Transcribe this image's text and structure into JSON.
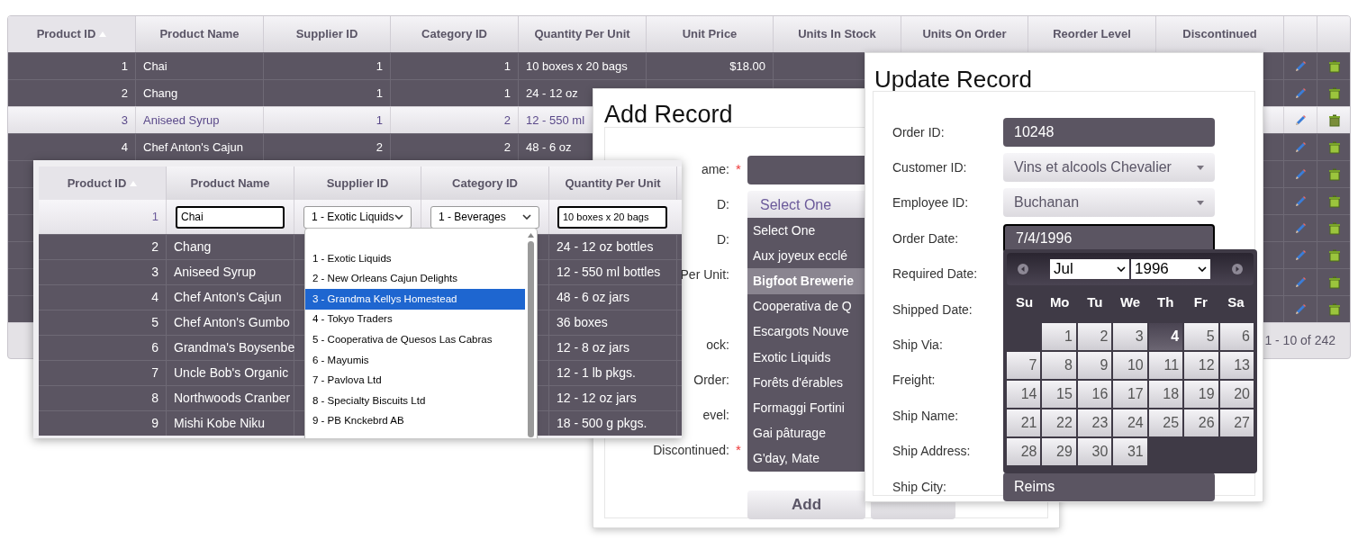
{
  "main_grid": {
    "columns": [
      {
        "label": "Product ID",
        "sorted": true
      },
      {
        "label": "Product Name",
        "sorted": false
      },
      {
        "label": "Supplier ID",
        "sorted": false
      },
      {
        "label": "Category ID",
        "sorted": false
      },
      {
        "label": "Quantity Per Unit",
        "sorted": false
      },
      {
        "label": "Unit Price",
        "sorted": false
      },
      {
        "label": "Units In Stock",
        "sorted": false
      },
      {
        "label": "Units On Order",
        "sorted": false
      },
      {
        "label": "Reorder Level",
        "sorted": false
      },
      {
        "label": "Discontinued",
        "sorted": false
      }
    ],
    "rows": [
      {
        "selected": false,
        "cells": [
          "1",
          "Chai",
          "1",
          "1",
          "10 boxes x 20 bags",
          "$18.00"
        ]
      },
      {
        "selected": false,
        "cells": [
          "2",
          "Chang",
          "1",
          "1",
          "24 - 12 oz"
        ]
      },
      {
        "selected": true,
        "cells": [
          "3",
          "Aniseed Syrup",
          "1",
          "2",
          "12 - 550 ml"
        ]
      },
      {
        "selected": false,
        "cells": [
          "4",
          "Chef Anton's Cajun",
          "2",
          "2",
          "48 - 6 oz"
        ]
      },
      {
        "selected": false
      },
      {
        "selected": false
      },
      {
        "selected": false
      },
      {
        "selected": false
      },
      {
        "selected": false
      },
      {
        "selected": false
      }
    ],
    "pager": "1 - 10 of 242"
  },
  "product_grid": {
    "columns": [
      {
        "label": "Product ID",
        "sorted": true
      },
      {
        "label": "Product Name",
        "sorted": false
      },
      {
        "label": "Supplier ID",
        "sorted": false
      },
      {
        "label": "Category ID",
        "sorted": false
      },
      {
        "label": "Quantity Per Unit",
        "sorted": false
      }
    ],
    "edit_row": {
      "product_id": "1",
      "product_name": "Chai",
      "supplier": "1 - Exotic Liquids",
      "category": "1 - Beverages",
      "quantity_per_unit": "10 boxes x 20 bags"
    },
    "rows": [
      {
        "product_id": "2",
        "product_name": "Chang",
        "quantity_per_unit": "24 - 12 oz bottles"
      },
      {
        "product_id": "3",
        "product_name": "Aniseed Syrup",
        "quantity_per_unit": "12 - 550 ml bottles"
      },
      {
        "product_id": "4",
        "product_name": "Chef Anton's Cajun",
        "quantity_per_unit": "48 - 6 oz jars"
      },
      {
        "product_id": "5",
        "product_name": "Chef Anton's Gumbo",
        "quantity_per_unit": "36 boxes"
      },
      {
        "product_id": "6",
        "product_name": "Grandma's Boysenbe",
        "quantity_per_unit": "12 - 8 oz jars"
      },
      {
        "product_id": "7",
        "product_name": "Uncle Bob's Organic",
        "quantity_per_unit": "12 - 1 lb pkgs."
      },
      {
        "product_id": "8",
        "product_name": "Northwoods Cranber",
        "quantity_per_unit": "12 - 12 oz jars"
      },
      {
        "product_id": "9",
        "product_name": "Mishi Kobe Niku",
        "quantity_per_unit": "18 - 500 g pkgs."
      }
    ],
    "supplier_options": [
      {
        "label": "1 - Exotic Liquids",
        "selected": false
      },
      {
        "label": "2 - New Orleans Cajun Delights",
        "selected": false
      },
      {
        "label": "3 - Grandma Kellys Homestead",
        "selected": true
      },
      {
        "label": "4 - Tokyo Traders",
        "selected": false
      },
      {
        "label": "5 - Cooperativa de Quesos Las Cabras",
        "selected": false
      },
      {
        "label": "6 - Mayumis",
        "selected": false
      },
      {
        "label": "7 - Pavlova Ltd",
        "selected": false
      },
      {
        "label": "8 - Specialty Biscuits Ltd",
        "selected": false
      },
      {
        "label": "9 - PB Knckebrd AB",
        "selected": false
      }
    ]
  },
  "add_record": {
    "title": "Add Record",
    "fields": [
      {
        "label": "ame:",
        "required": true
      },
      {
        "label": "D:",
        "required": false
      },
      {
        "label": "D:",
        "required": false
      },
      {
        "label": "Per Unit:",
        "required": false
      },
      {
        "required": false
      },
      {
        "label": "ock:",
        "required": false
      },
      {
        "label": "Order:",
        "required": false
      },
      {
        "label": "evel:",
        "required": false
      },
      {
        "label": "Discontinued:",
        "required": true
      }
    ],
    "required_mark": "*",
    "supplier_select": "Select One",
    "supplier_options": [
      {
        "label": "Select One",
        "selected": false
      },
      {
        "label": "Aux joyeux ecclé",
        "selected": false
      },
      {
        "label": "Bigfoot Brewerie",
        "selected": true
      },
      {
        "label": "Cooperativa de Q",
        "selected": false
      },
      {
        "label": "Escargots Nouve",
        "selected": false
      },
      {
        "label": "Exotic Liquids",
        "selected": false
      },
      {
        "label": "Forêts d'érables",
        "selected": false
      },
      {
        "label": "Formaggi Fortini",
        "selected": false
      },
      {
        "label": "Gai pâturage",
        "selected": false
      },
      {
        "label": "G'day, Mate",
        "selected": false
      }
    ],
    "buttons": [
      "Add"
    ]
  },
  "update_record": {
    "title": "Update Record",
    "fields": [
      {
        "label": "Order ID:",
        "kind": "text",
        "value": "10248",
        "focused": false
      },
      {
        "label": "Customer ID:",
        "kind": "select",
        "value": "Vins et alcools Chevalier"
      },
      {
        "label": "Employee ID:",
        "kind": "select",
        "value": "Buchanan"
      },
      {
        "label": "Order Date:",
        "kind": "text",
        "value": "7/4/1996",
        "focused": true
      },
      {
        "label": "Required Date:",
        "kind": "label_only"
      },
      {
        "label": "Shipped Date:",
        "kind": "label_only"
      },
      {
        "label": "Ship Via:",
        "kind": "label_only"
      },
      {
        "label": "Freight:",
        "kind": "label_only"
      },
      {
        "label": "Ship Name:",
        "kind": "label_only"
      },
      {
        "label": "Ship Address:",
        "kind": "label_only"
      },
      {
        "label": "Ship City:",
        "kind": "text",
        "value": "Reims",
        "focused": false
      }
    ],
    "calendar": {
      "month": "Jul",
      "year": "1996",
      "weekdays": [
        "Su",
        "Mo",
        "Tu",
        "We",
        "Th",
        "Fr",
        "Sa"
      ],
      "weeks": [
        [
          {
            "kind": "blank"
          },
          {
            "label": "1",
            "selected": false
          },
          {
            "label": "2",
            "selected": false
          },
          {
            "label": "3",
            "selected": false
          },
          {
            "label": "4",
            "selected": true
          },
          {
            "label": "5",
            "selected": false
          },
          {
            "label": "6",
            "selected": false
          }
        ],
        [
          {
            "label": "7",
            "selected": false
          },
          {
            "label": "8",
            "selected": false
          },
          {
            "label": "9",
            "selected": false
          },
          {
            "label": "10",
            "selected": false
          },
          {
            "label": "11",
            "selected": false
          },
          {
            "label": "12",
            "selected": false
          },
          {
            "label": "13",
            "selected": false
          }
        ],
        [
          {
            "label": "14",
            "selected": false
          },
          {
            "label": "15",
            "selected": false
          },
          {
            "label": "16",
            "selected": false
          },
          {
            "label": "17",
            "selected": false
          },
          {
            "label": "18",
            "selected": false
          },
          {
            "label": "19",
            "selected": false
          },
          {
            "label": "20",
            "selected": false
          }
        ],
        [
          {
            "label": "21",
            "selected": false
          },
          {
            "label": "22",
            "selected": false
          },
          {
            "label": "23",
            "selected": false
          },
          {
            "label": "24",
            "selected": false
          },
          {
            "label": "25",
            "selected": false
          },
          {
            "label": "26",
            "selected": false
          },
          {
            "label": "27",
            "selected": false
          }
        ],
        [
          {
            "label": "28",
            "selected": false
          },
          {
            "label": "29",
            "selected": false
          },
          {
            "label": "30",
            "selected": false
          },
          {
            "label": "31",
            "selected": false
          },
          {
            "kind": "blank"
          },
          {
            "kind": "blank"
          },
          {
            "kind": "blank"
          }
        ]
      ]
    }
  }
}
